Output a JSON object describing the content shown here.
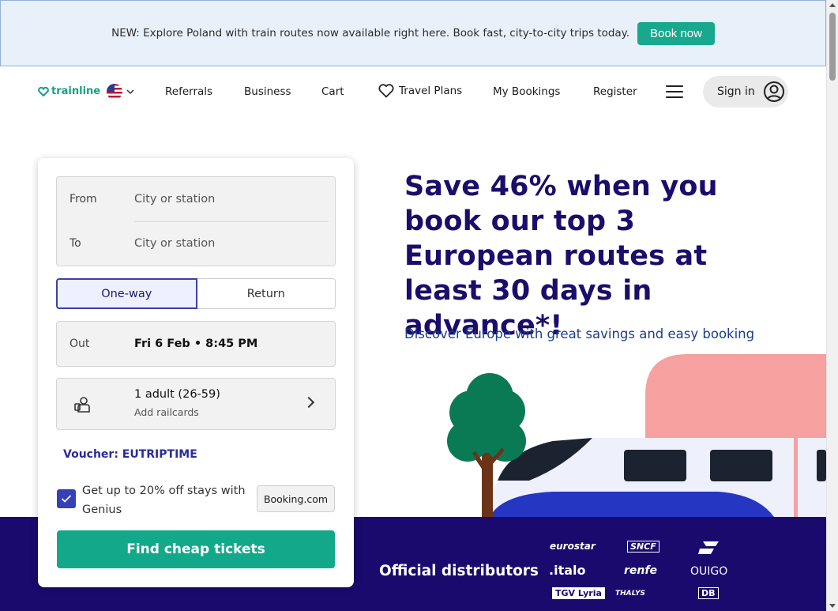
{
  "banner": {
    "text": "NEW: Explore Poland with train routes now available right here. Book fast, city-to-city trips today.",
    "button": "Book now"
  },
  "nav": {
    "logo": "trainline",
    "flag_icon": "us-flag-icon",
    "links": {
      "referrals": "Referrals",
      "business": "Business",
      "cart": "Cart",
      "travel_plans": "Travel Plans",
      "my_bookings": "My Bookings",
      "register": "Register"
    },
    "sign_in": "Sign in"
  },
  "search": {
    "from_label": "From",
    "from_placeholder": "City or station",
    "to_label": "To",
    "to_placeholder": "City or station",
    "trip_types": {
      "one_way": "One-way",
      "return": "Return"
    },
    "selected_trip": "One-way",
    "out_label": "Out",
    "out_value": "Fri 6 Feb • 8:45 PM",
    "passengers": "1 adult (26-59)",
    "railcards": "Add railcards",
    "voucher": "Voucher: EUTRIPTIME",
    "genius_text": "Get up to 20% off stays with Genius",
    "genius_checked": true,
    "booking_logo": "Booking.com",
    "submit": "Find cheap tickets"
  },
  "hero": {
    "title": "Save 46% when you book our top 3 European routes at least 30 days in advance*!",
    "subtitle": "Discover Europe with great savings and easy booking"
  },
  "distributors": {
    "label": "Official distributors",
    "partners": {
      "eurostar": "eurostar",
      "sncf": "SNCF",
      "renfe_icon": "renfe-icon",
      "italo": ".italo",
      "renfe": "renfe",
      "ouigo": "OUIGO",
      "tgv": "TGV Lyria",
      "thalys": "THALYS",
      "db": "DB"
    }
  },
  "colors": {
    "brand_green": "#14a88b",
    "hero_navy": "#1b0d6b",
    "band_navy": "#1a0a6e",
    "accent_blue": "#3640b6"
  }
}
